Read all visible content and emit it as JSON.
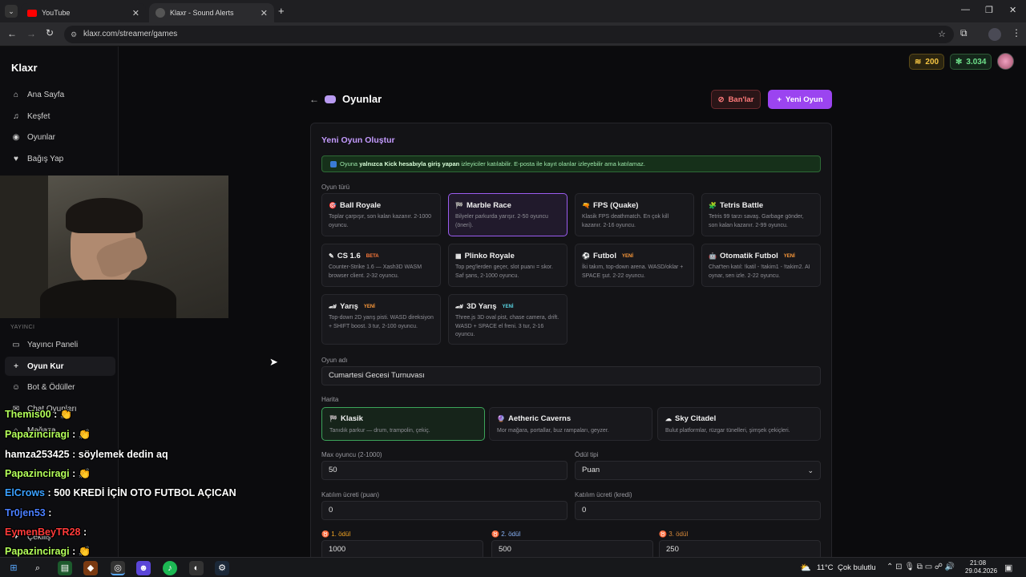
{
  "browser": {
    "tabs": [
      {
        "title": "YouTube",
        "active": false
      },
      {
        "title": "Klaxr - Sound Alerts",
        "active": true
      }
    ],
    "url": "klaxr.com/streamer/games"
  },
  "brand": {
    "logo": "Klaxr",
    "accent": "#9bdc3c"
  },
  "sidebar": {
    "items": [
      {
        "label": "Ana Sayfa",
        "icon": "home-icon"
      },
      {
        "label": "Keşfet",
        "icon": "music-icon"
      },
      {
        "label": "Oyunlar",
        "icon": "gamepad-icon"
      },
      {
        "label": "Bağış Yap",
        "icon": "heart-icon"
      }
    ],
    "section_label": "YAYINCI",
    "streamer_items": [
      {
        "label": "Yayıncı Paneli",
        "icon": "monitor-icon"
      },
      {
        "label": "Oyun Kur",
        "icon": "plus-icon",
        "active": true
      },
      {
        "label": "Bot & Ödüller",
        "icon": "bot-icon"
      },
      {
        "label": "Chat Oyunları",
        "icon": "chat-icon"
      },
      {
        "label": "Mağaza",
        "icon": "store-icon"
      },
      {
        "label": "Çekiliş",
        "icon": "gift-icon"
      }
    ]
  },
  "topbar": {
    "points": "200",
    "credits": "3.034"
  },
  "page": {
    "title": "Oyunlar",
    "bans_button": "Ban'lar",
    "new_game_button": "Yeni Oyun"
  },
  "form": {
    "heading": "Yeni Oyun Oluştur",
    "info_prefix": "Oyuna ",
    "info_bold": "yalnızca Kick hesabıyla giriş yapan",
    "info_suffix": " izleyiciler katılabilir. E-posta ile kayıt olanlar izleyebilir ama katılamaz.",
    "game_type_label": "Oyun türü",
    "games": [
      {
        "title": "Ball Royale",
        "desc": "Toplar çarpışır, son kalan kazanır. 2-1000 oyuncu.",
        "badge": "",
        "icon": "target-icon"
      },
      {
        "title": "Marble Race",
        "desc": "Bilyeler parkurda yarışır. 2-50 oyuncu (öneri).",
        "badge": "",
        "icon": "flag-icon",
        "selected": true
      },
      {
        "title": "FPS (Quake)",
        "desc": "Klasik FPS deathmatch. En çok kill kazanır. 2-16 oyuncu.",
        "badge": "",
        "icon": "gun-icon"
      },
      {
        "title": "Tetris Battle",
        "desc": "Tetris 99 tarzı savaş. Garbage gönder, son kalan kazanır. 2-99 oyuncu.",
        "badge": "",
        "icon": "blocks-icon"
      },
      {
        "title": "CS 1.6",
        "desc": "Counter-Strike 1.6 — Xash3D WASM browser client. 2-32 oyuncu.",
        "badge": "BETA",
        "icon": "rifle-icon"
      },
      {
        "title": "Plinko Royale",
        "desc": "Top peg'lerden geçer, slot puanı = skor. Saf şans, 2-1000 oyuncu.",
        "badge": "",
        "icon": "plinko-icon"
      },
      {
        "title": "Futbol",
        "desc": "İki takım, top-down arena. WASD/oklar + SPACE şut. 2-22 oyuncu.",
        "badge": "YENİ",
        "icon": "ball-icon"
      },
      {
        "title": "Otomatik Futbol",
        "desc": "Chat'ten katıl: !katil - !takim1 - !takim2. AI oynar, sen izle. 2-22 oyuncu.",
        "badge": "YENİ",
        "icon": "robot-icon"
      },
      {
        "title": "Yarış",
        "desc": "Top-down 2D yarış pisti. WASD direksiyon + SHIFT boost. 3 tur, 2-100 oyuncu.",
        "badge": "YENİ",
        "icon": "car-icon"
      },
      {
        "title": "3D Yarış",
        "desc": "Three.js 3D oval pist, chase camera, drift. WASD + SPACE el freni. 3 tur, 2-16 oyuncu.",
        "badge": "YENİ",
        "icon": "car3d-icon"
      }
    ],
    "game_name_label": "Oyun adı",
    "game_name_value": "Cumartesi Gecesi Turnuvası",
    "map_label": "Harita",
    "maps": [
      {
        "title": "Klasik",
        "desc": "Tanıdık parkur — drum, trampolin, çekiç.",
        "icon": "flag-icon",
        "selected": true
      },
      {
        "title": "Aetheric Caverns",
        "desc": "Mor mağara, portallar, buz rampaları, geyzer.",
        "icon": "crystal-icon"
      },
      {
        "title": "Sky Citadel",
        "desc": "Bulut platformlar, rüzgar tünelleri, şimşek çekiçleri.",
        "icon": "cloud-icon"
      }
    ],
    "max_players_label": "Max oyuncu (2-1000)",
    "max_players_value": "50",
    "reward_type_label": "Ödül tipi",
    "reward_type_value": "Puan",
    "entry_fee_points_label": "Katılım ücreti (puan)",
    "entry_fee_points_value": "0",
    "entry_fee_credits_label": "Katılım ücreti (kredi)",
    "entry_fee_credits_value": "0",
    "prizes": [
      {
        "label": "1. ödül",
        "value": "1000",
        "color": "#f5a623"
      },
      {
        "label": "2. ödül",
        "value": "500",
        "color": "#8ab4f8"
      },
      {
        "label": "3. ödül",
        "value": "250",
        "color": "#d98a3a"
      }
    ]
  },
  "chat_overlay": [
    {
      "user": "Themis00",
      "text": ":",
      "emote": "👏",
      "color": "#b4ff5a"
    },
    {
      "user": "Papazinciragi",
      "text": ":",
      "emote": "👏",
      "color": "#b4ff5a"
    },
    {
      "user": "hamza253425",
      "text": ": söylemek dedin aq",
      "emote": "",
      "color": "#ffffff"
    },
    {
      "user": "Papazinciragi",
      "text": ":",
      "emote": "👏",
      "color": "#b4ff5a"
    },
    {
      "user": "ElCrows",
      "text": ": 500 KREDİ İÇİN OTO FUTBOL AÇICAN",
      "emote": "",
      "color": "#3aa0ff"
    },
    {
      "user": "Tr0jen53",
      "text": ":",
      "emote": "",
      "color": "#4a7fff"
    },
    {
      "user": "EymenBeyTR28",
      "text": ":",
      "emote": "",
      "color": "#ff3a3a"
    },
    {
      "user": "Papazinciragi",
      "text": ":",
      "emote": "👏",
      "color": "#b4ff5a"
    }
  ],
  "taskbar": {
    "weather": "11°C",
    "weather_desc": "Çok bulutlu",
    "time": "21:08",
    "date": "29.04.2026"
  }
}
